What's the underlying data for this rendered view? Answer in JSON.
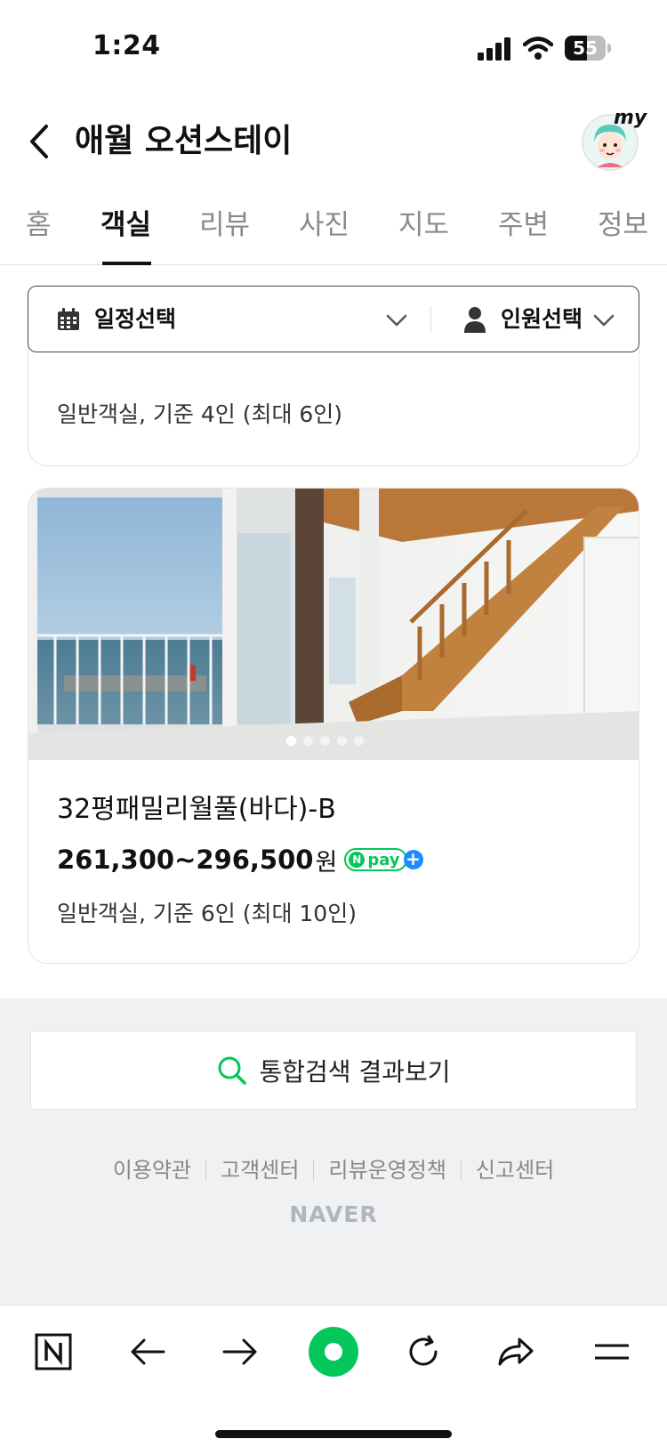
{
  "status_bar": {
    "time": "1:24",
    "battery_percent": 55,
    "battery_label": "55"
  },
  "header": {
    "title": "애월 오션스테이",
    "my_label": "my"
  },
  "tabs": [
    {
      "label": "홈",
      "active": false
    },
    {
      "label": "객실",
      "active": true
    },
    {
      "label": "리뷰",
      "active": false
    },
    {
      "label": "사진",
      "active": false
    },
    {
      "label": "지도",
      "active": false
    },
    {
      "label": "주변",
      "active": false
    },
    {
      "label": "정보",
      "active": false
    }
  ],
  "filter": {
    "date_label": "일정선택",
    "guest_label": "인원선택"
  },
  "rooms": [
    {
      "subtitle": "일반객실, 기준 4인 (최대 6인)"
    },
    {
      "name": "32평패밀리월풀(바다)-B",
      "price": "261,300~296,500",
      "price_unit": "원",
      "npay_label": "pay",
      "npay_n": "N",
      "npay_plus": "+",
      "subtitle": "일반객실, 기준 6인 (최대 10인)",
      "photo_count": 5,
      "photo_current": 1
    }
  ],
  "search_button": {
    "label": "통합검색 결과보기"
  },
  "footer": {
    "links": [
      "이용약관",
      "고객센터",
      "리뷰운영정책",
      "신고센터"
    ],
    "logo": "NAVER"
  },
  "bottom_nav": {
    "icons": [
      "naver-n-icon",
      "back-arrow-icon",
      "forward-arrow-icon",
      "green-dot-home-icon",
      "refresh-icon",
      "share-icon",
      "menu-icon"
    ]
  },
  "colors": {
    "naver_green": "#03c75a",
    "text": "#111111",
    "muted": "#8a8a8a",
    "footer_bg": "#f0f1f3"
  }
}
